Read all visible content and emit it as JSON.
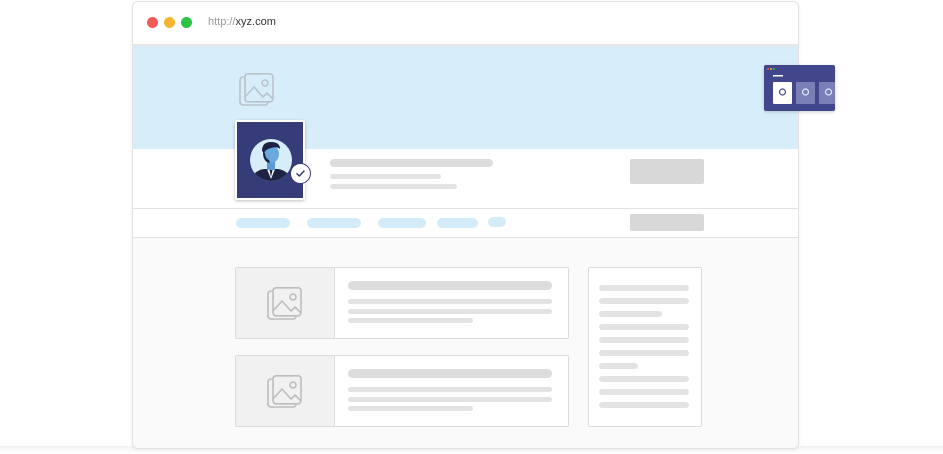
{
  "browser": {
    "url_protocol": "http://",
    "url_host": "xyz.com"
  },
  "icons": {
    "banner_image": "image-placeholder-icon",
    "avatar": "person-avatar-icon",
    "verified": "checkmark-icon",
    "card_image": "image-placeholder-icon",
    "widget_item": "gear-icon"
  },
  "colors": {
    "banner": "#d7eefa",
    "avatar_bg": "#363c78",
    "nav_pill": "#d4ecf9",
    "skeleton": "#dcdcdc",
    "close_dot": "#f25a57",
    "minimize_dot": "#f8b530",
    "maximize_dot": "#2cc443"
  }
}
